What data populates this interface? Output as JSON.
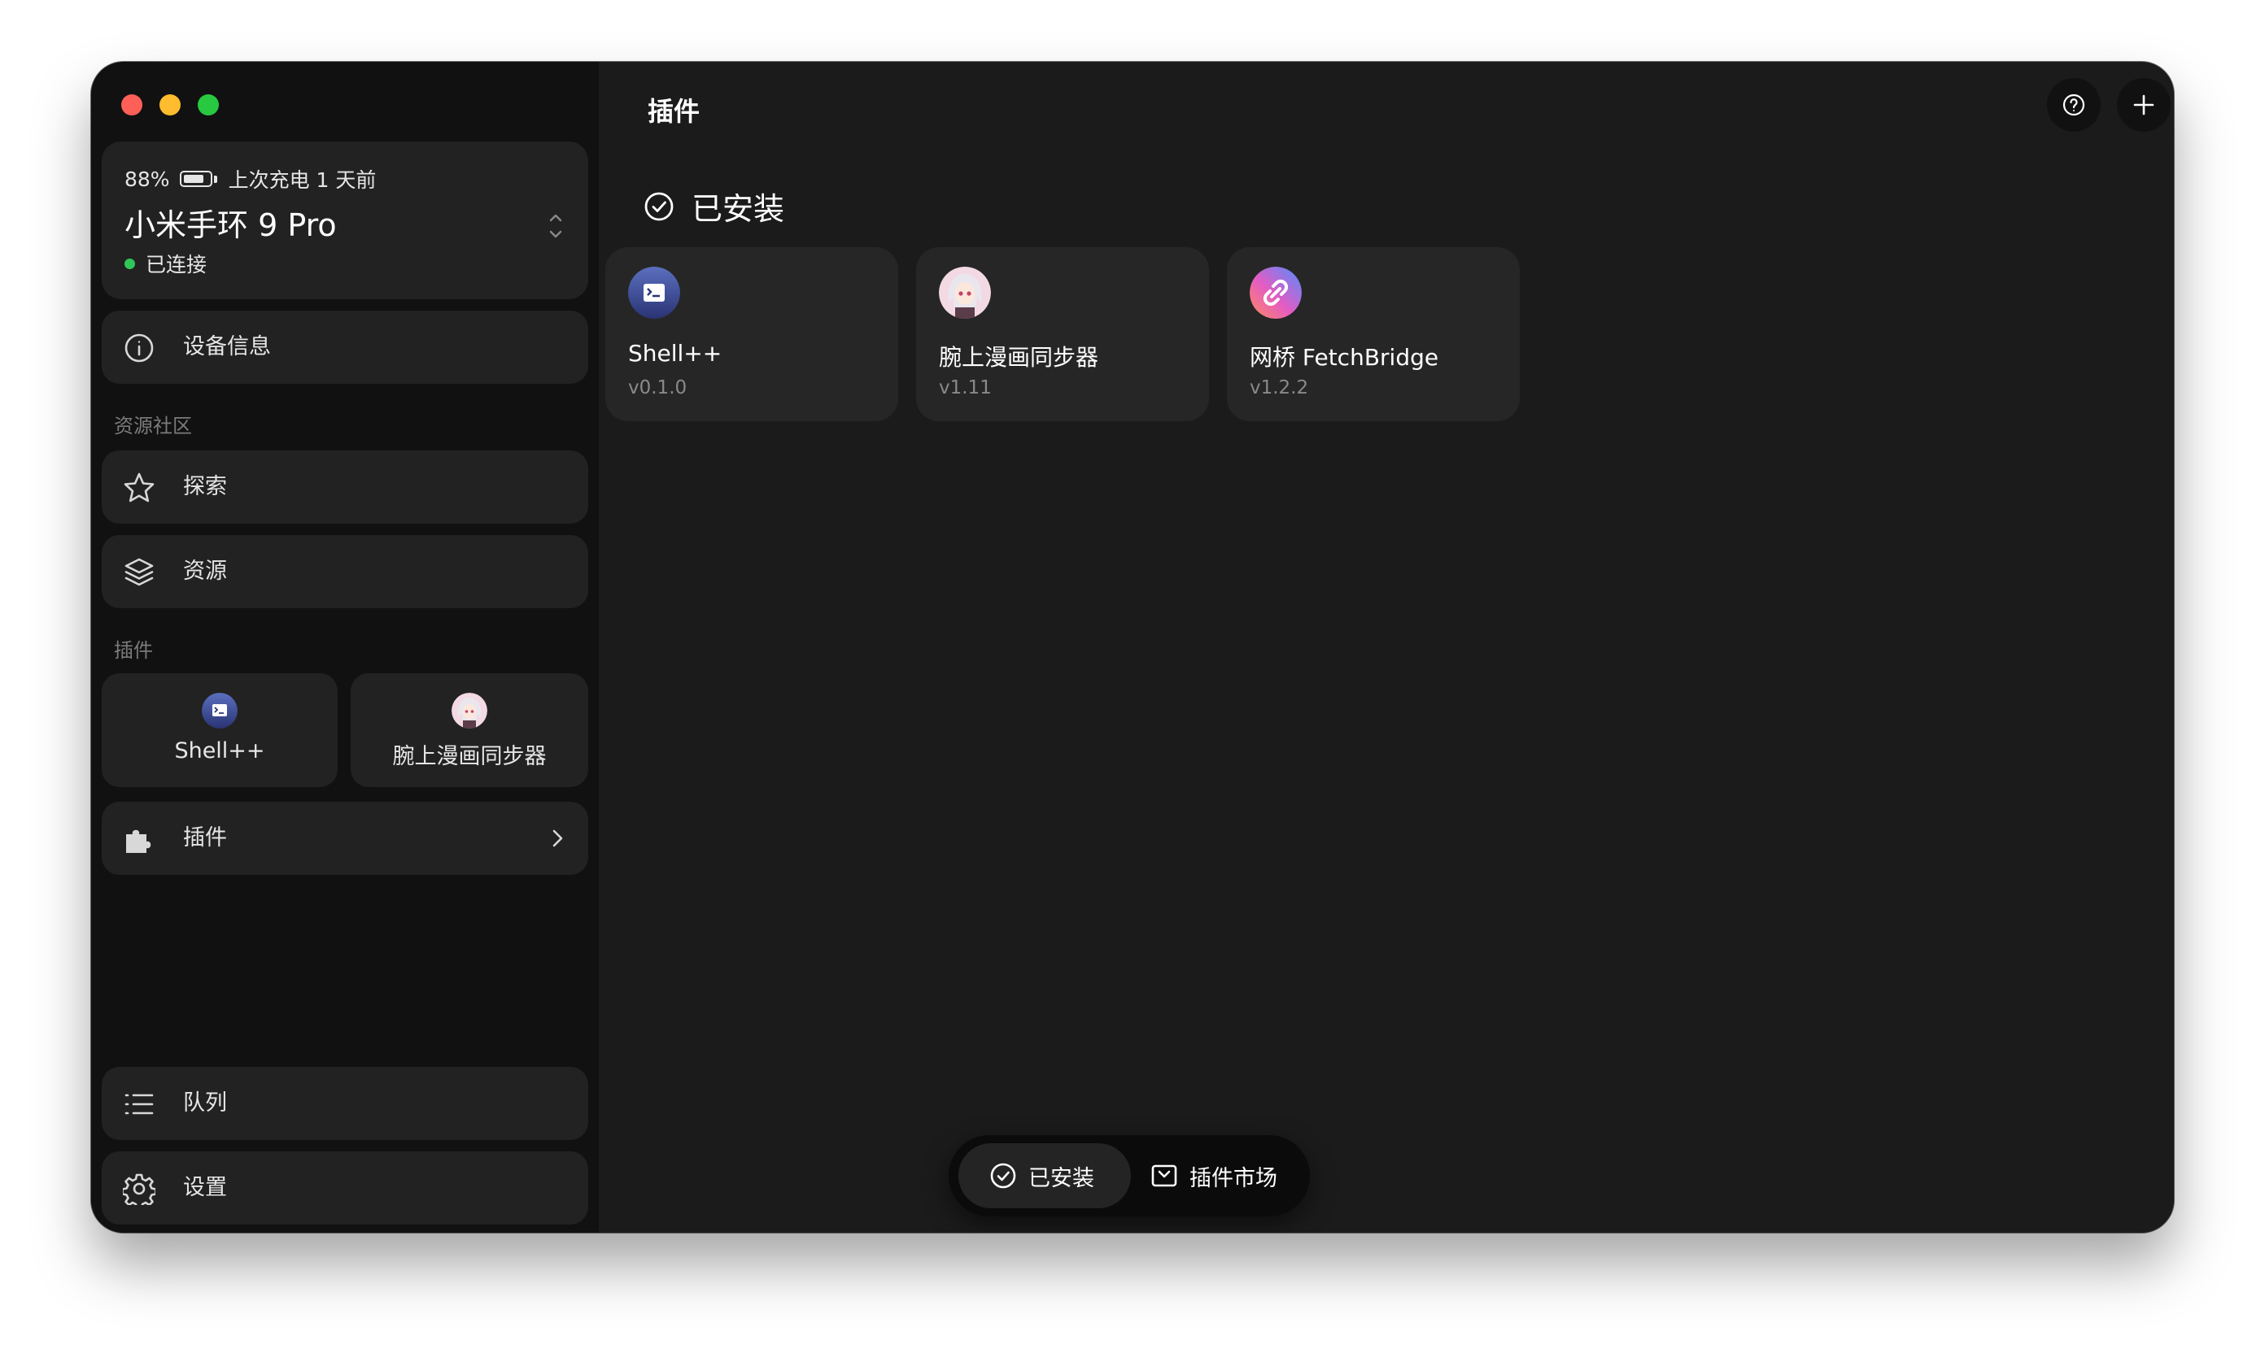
{
  "window": {
    "controls": [
      "close",
      "minimize",
      "maximize"
    ]
  },
  "device": {
    "battery_percent": "88%",
    "battery_level": 0.88,
    "last_charge": "上次充电 1 天前",
    "name": "小米手环 9 Pro",
    "status": "已连接",
    "status_color": "#30c759"
  },
  "sidebar": {
    "device_info": {
      "label": "设备信息",
      "icon": "info-icon"
    },
    "community_section": "资源社区",
    "explore": {
      "label": "探索",
      "icon": "star-icon"
    },
    "resources": {
      "label": "资源",
      "icon": "layers-icon"
    },
    "plugins_section": "插件",
    "plugin_shortcuts": [
      {
        "label": "Shell++",
        "icon": "shell-plugin-icon"
      },
      {
        "label": "腕上漫画同步器",
        "icon": "anime-avatar-icon"
      }
    ],
    "plugins": {
      "label": "插件",
      "icon": "puzzle-icon"
    },
    "queue": {
      "label": "队列",
      "icon": "list-icon"
    },
    "settings": {
      "label": "设置",
      "icon": "gear-icon"
    }
  },
  "main": {
    "title": "插件",
    "help_icon": "help-icon",
    "add_icon": "plus-icon",
    "installed_heading": "已安装",
    "plugins": [
      {
        "name": "Shell++",
        "version": "v0.1.0",
        "icon": "shell-plugin-icon"
      },
      {
        "name": "腕上漫画同步器",
        "version": "v1.11",
        "icon": "anime-avatar-icon"
      },
      {
        "name": "网桥 FetchBridge",
        "version": "v1.2.2",
        "icon": "link-gradient-icon"
      }
    ]
  },
  "bottom_bar": {
    "installed": "已安装",
    "market": "插件市场",
    "active": "installed"
  }
}
